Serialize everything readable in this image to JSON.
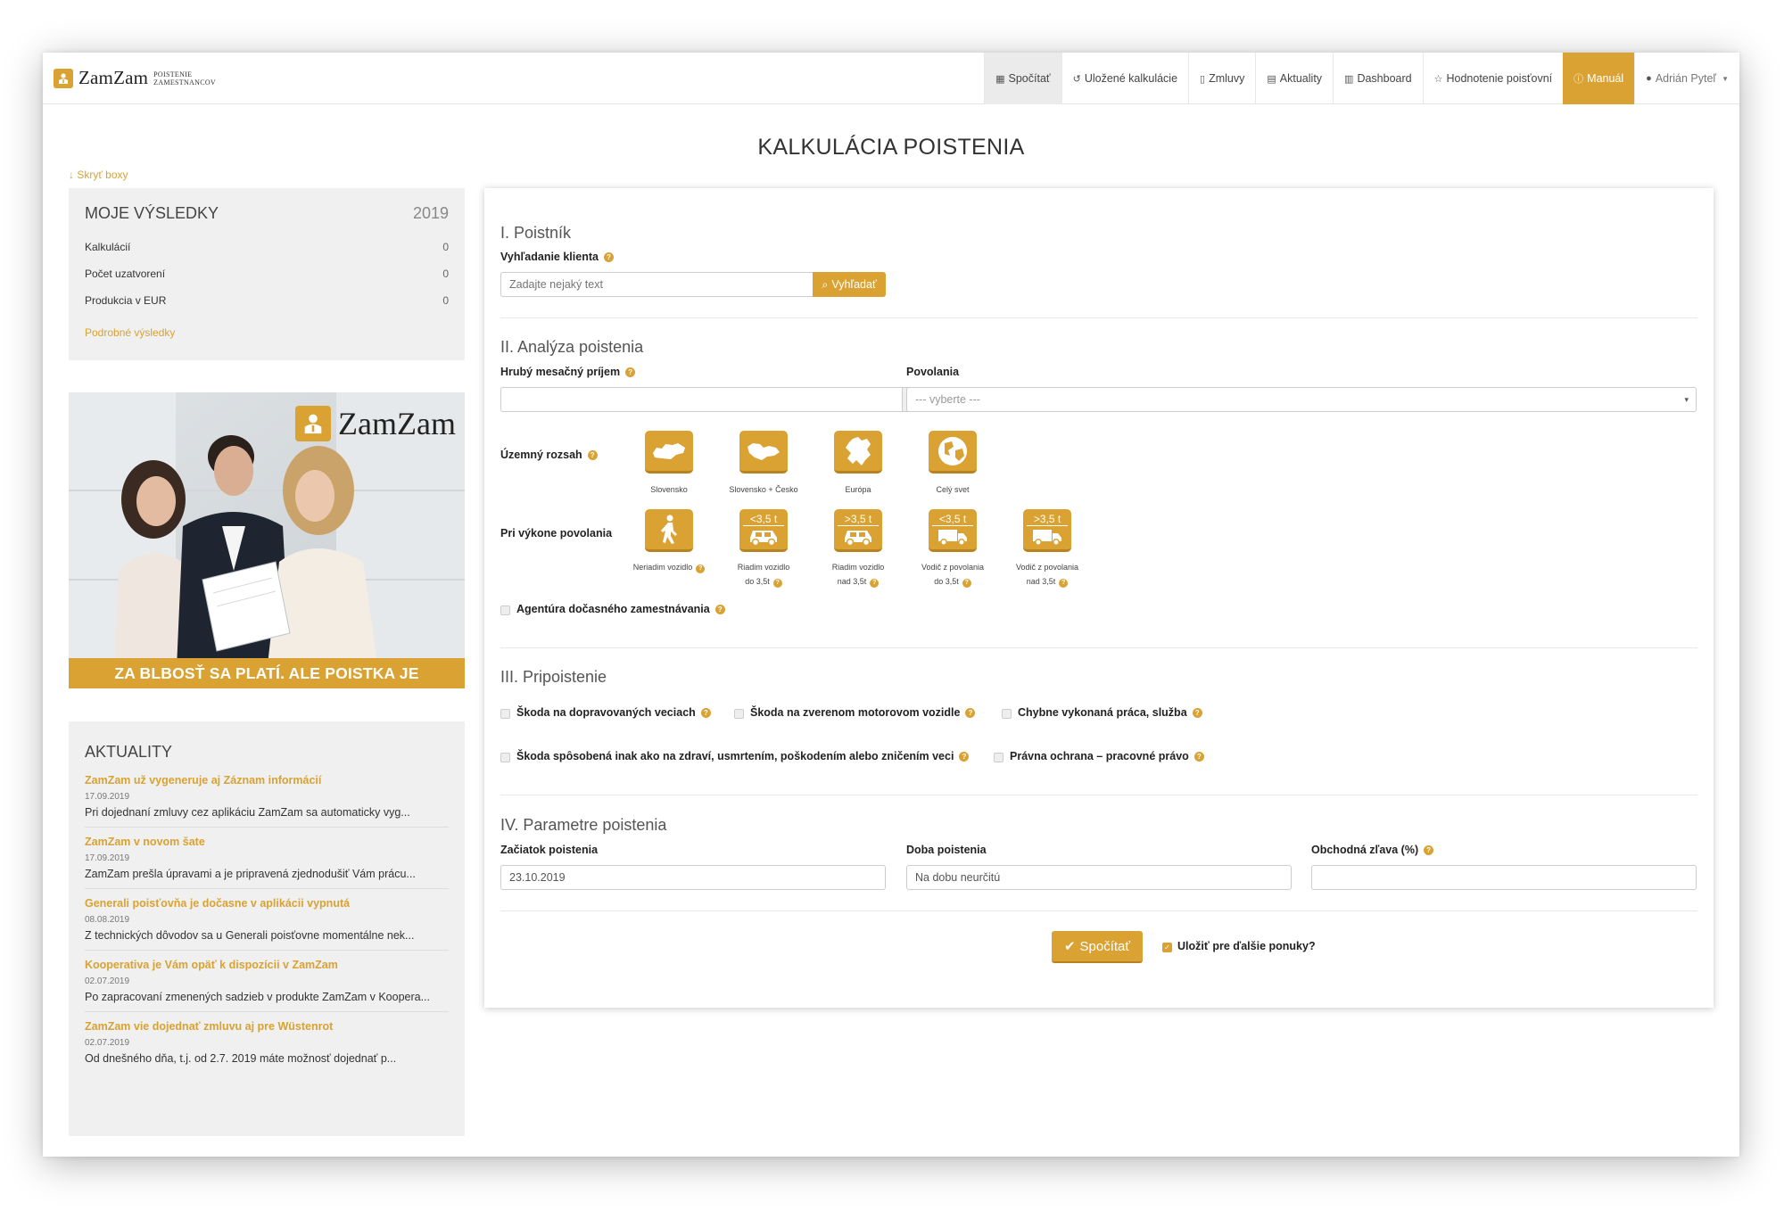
{
  "brand": {
    "name": "ZamZam",
    "sub_line1": "POISTENIE",
    "sub_line2": "ZAMESTNANCOV"
  },
  "nav": {
    "calc": "Spočítať",
    "saved": "Uložené kalkulácie",
    "contracts": "Zmluvy",
    "news": "Aktuality",
    "dashboard": "Dashboard",
    "rating": "Hodnotenie poisťovní",
    "manual": "Manuál",
    "user": "Adrián Pyteľ"
  },
  "page_title": "KALKULÁCIA POISTENIA",
  "hide_boxes": "↓ Skryť boxy",
  "results": {
    "title": "MOJE VÝSLEDKY",
    "year": "2019",
    "rows": [
      {
        "label": "Kalkulácií",
        "value": "0"
      },
      {
        "label": "Počet uzatvorení",
        "value": "0"
      },
      {
        "label": "Produkcia v EUR",
        "value": "0"
      }
    ],
    "more": "Podrobné výsledky"
  },
  "banner": {
    "logo": "ZamZam",
    "caption": "ZA BLBOSŤ SA PLATÍ. ALE POISTKA JE LACNEJŠIA."
  },
  "news": {
    "title": "AKTUALITY",
    "items": [
      {
        "title": "ZamZam už vygeneruje aj Záznam informácií",
        "date": "17.09.2019",
        "text": "Pri dojednaní zmluvy cez aplikáciu ZamZam sa automaticky vyg..."
      },
      {
        "title": "ZamZam v novom šate",
        "date": "17.09.2019",
        "text": "ZamZam prešla úpravami a je pripravená zjednodušiť Vám prácu..."
      },
      {
        "title": "Generali poisťovňa je dočasne v aplikácii vypnutá",
        "date": "08.08.2019",
        "text": "Z technických dôvodov sa u Generali poisťovne momentálne nek..."
      },
      {
        "title": "Kooperativa je Vám opäť k dispozícii v ZamZam",
        "date": "02.07.2019",
        "text": "Po zapracovaní zmenených sadzieb v produkte ZamZam v Koopera..."
      },
      {
        "title": "ZamZam vie dojednať zmluvu aj pre Wüstenrot",
        "date": "02.07.2019",
        "text": "Od dnešného dňa, t.j. od 2.7. 2019 máte možnosť dojednať p..."
      }
    ]
  },
  "form": {
    "s1": {
      "title": "I. Poistník",
      "search_label": "Vyhľadanie klienta",
      "search_placeholder": "Zadajte nejaký text",
      "search_button": "Vyhľadať"
    },
    "s2": {
      "title": "II. Analýza poistenia",
      "income_label": "Hrubý mesačný príjem",
      "income_value": "",
      "currency": "€",
      "occupation_label": "Povolania",
      "occupation_value": "--- vyberte ---",
      "territory_label": "Územný rozsah",
      "territory": [
        {
          "label": "Slovensko",
          "icon": "slovakia-map-icon"
        },
        {
          "label": "Slovensko + Česko",
          "icon": "sk-cz-map-icon"
        },
        {
          "label": "Európa",
          "icon": "europe-map-icon"
        },
        {
          "label": "Celý svet",
          "icon": "globe-icon"
        }
      ],
      "job_label": "Pri výkone povolania",
      "job": [
        {
          "line1": "Neriadim vozidlo",
          "line2": "",
          "badge": "",
          "icon": "walking-person-icon"
        },
        {
          "line1": "Riadim vozidlo",
          "line2": "do 3,5t",
          "badge": "<3,5 t",
          "icon": "car-icon"
        },
        {
          "line1": "Riadim vozidlo",
          "line2": "nad 3,5t",
          "badge": ">3,5 t",
          "icon": "car-icon"
        },
        {
          "line1": "Vodič z povolania",
          "line2": "do 3,5t",
          "badge": "<3,5 t",
          "icon": "truck-icon"
        },
        {
          "line1": "Vodič z povolania",
          "line2": "nad 3,5t",
          "badge": ">3,5 t",
          "icon": "truck-icon"
        }
      ],
      "agency_label": "Agentúra dočasného zamestnávania"
    },
    "s3": {
      "title": "III. Pripoistenie",
      "opt1": "Škoda na dopravovaných veciach",
      "opt2": "Škoda na zverenom motorovom vozidle",
      "opt3": "Chybne vykonaná práca, služba",
      "opt4": "Škoda spôsobená inak ako na zdraví, usmrtením, poškodením alebo zničením veci",
      "opt5": "Právna ochrana – pracovné právo"
    },
    "s4": {
      "title": "IV. Parametre poistenia",
      "start_label": "Začiatok poistenia",
      "start_value": "23.10.2019",
      "duration_label": "Doba poistenia",
      "duration_value": "Na dobu neurčitú",
      "discount_label": "Obchodná zľava (%)",
      "discount_value": ""
    },
    "submit": "Spočítať",
    "save_label": "Uložiť pre ďalšie ponuky?"
  },
  "colors": {
    "accent": "#d9a232",
    "nav_active": "#ebebeb",
    "sidebar_bg": "#f0f0f0"
  }
}
